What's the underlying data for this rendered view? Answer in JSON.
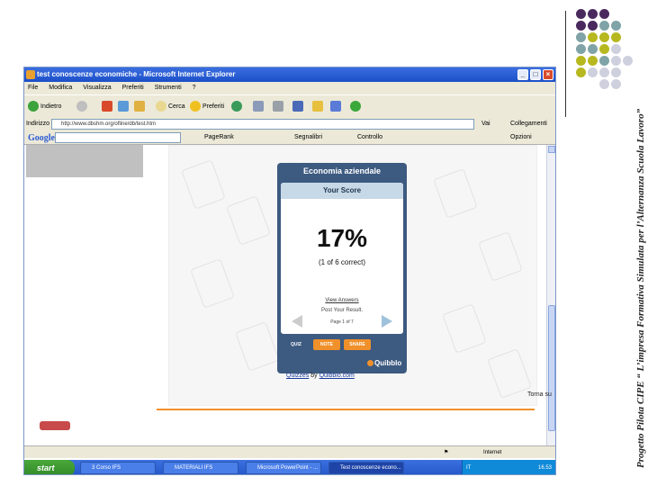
{
  "side_title": "Progetto Pilota CIPE “ L’impresa Formativa Simulata per l’Alternanza Scuola Lavoro”",
  "colors": {
    "purple": "#4a2a5e",
    "teal": "#7fa3a6",
    "olive": "#b7b820",
    "lightgray": "#cfd0de",
    "quiz_blue": "#3d5a80",
    "orange": "#f0902a"
  },
  "window": {
    "title": "test conoscenze economiche - Microsoft Internet Explorer",
    "menu": [
      "File",
      "Modifica",
      "Visualizza",
      "Preferiti",
      "Strumenti",
      "?"
    ],
    "toolbar": {
      "back": "Indietro",
      "search": "Cerca",
      "favorites": "Preferiti"
    },
    "address_label": "Indirizzo",
    "address": "http://www.dbshm.org/ofline/db/test.htm",
    "go": "Vai",
    "links": "Collegamenti",
    "google_bar": {
      "logo": "Google",
      "tools": [
        "PageRank",
        "Segnalibri",
        "Controllo",
        "Opzioni"
      ]
    },
    "status_right": "Internet"
  },
  "quiz": {
    "title": "Economia aziendale",
    "score_label": "Your Score",
    "score": "17%",
    "correct": "(1 of 6 correct)",
    "view_answers": "View Answers",
    "post_result": "Post Your Result.",
    "page": "Page 1 of 7",
    "tabs": [
      "QUIZ",
      "NOTE",
      "SHARE"
    ],
    "brand": "Quibblo",
    "footer_quizzes": "Quizzes",
    "footer_by": " by ",
    "footer_site": "Quibblo.com"
  },
  "torna_su": "Torna su",
  "taskbar": {
    "start": "start",
    "items": [
      "3 Corso IFS",
      "MATERIALI IFS",
      "Microsoft PowerPoint - ...",
      "Test conoscenze econo..."
    ],
    "tray_lang": "IT",
    "time": "16.53"
  }
}
